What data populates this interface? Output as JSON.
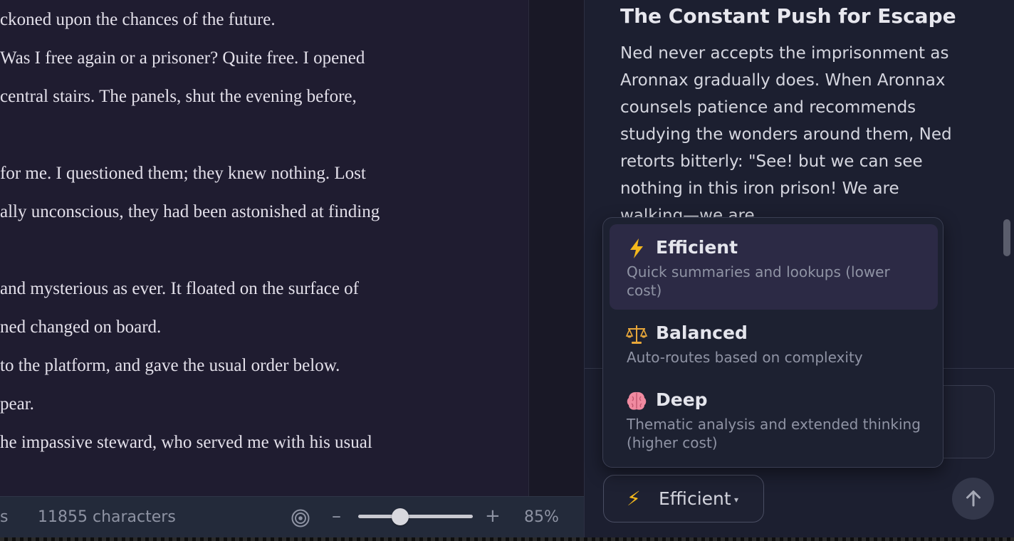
{
  "reader": {
    "lines": [
      "ckoned upon the chances of the future.",
      "Was I free again or a prisoner? Quite free. I opened",
      "central stairs. The panels, shut the evening before,",
      "",
      "for me. I questioned them; they knew nothing. Lost",
      "ally unconscious, they had been astonished at finding",
      "",
      "and mysterious as ever. It floated on the surface of",
      "ned changed on board.",
      "to the platform, and gave the usual order below.",
      "pear.",
      "he impassive steward, who served me with his usual"
    ]
  },
  "status_bar": {
    "left_fragment": "s",
    "characters": "11855 characters",
    "zoom_minus": "–",
    "zoom_plus": "+",
    "zoom_percent": "85%",
    "zoom_level": 0.85
  },
  "assistant": {
    "message_title": "The Constant Push for Escape",
    "message_body": "Ned never accepts the imprisonment as Aronnax gradually does. When Aronnax counsels patience and recommends studying the wonders around them, Ned retorts bitterly: \"See! but we can see nothing in this iron prison! We are walking—we are"
  },
  "model_selector": {
    "current_label": "Efficient",
    "current_icon": "lightning-icon",
    "caret": "▾",
    "options": [
      {
        "label": "Efficient",
        "icon": "lightning-icon",
        "description": "Quick summaries and lookups (lower cost)",
        "selected": true
      },
      {
        "label": "Balanced",
        "icon": "scales-icon",
        "description": "Auto-routes based on complexity",
        "selected": false
      },
      {
        "label": "Deep",
        "icon": "brain-icon",
        "description": "Thematic analysis and extended thinking (higher cost)",
        "selected": false
      }
    ]
  },
  "colors": {
    "accent_bolt": "#f4b81c",
    "selected_option_bg": "#2c2a45",
    "panel_bg": "#1c1f30",
    "reader_bg": "#1f1c30"
  }
}
